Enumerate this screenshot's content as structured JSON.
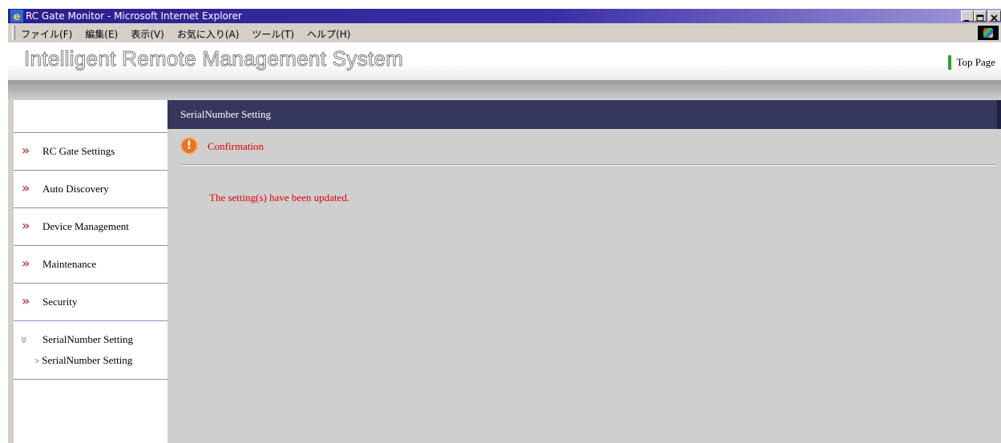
{
  "window": {
    "title": "RC Gate Monitor - Microsoft Internet Explorer",
    "buttons": {
      "minimize": "_",
      "maximize": "□",
      "close": "×"
    }
  },
  "menu": {
    "items": [
      "ファイル(F)",
      "編集(E)",
      "表示(V)",
      "お気に入り(A)",
      "ツール(T)",
      "ヘルプ(H)"
    ]
  },
  "banner": {
    "title": "Intelligent Remote Management System",
    "top_page": "Top Page",
    "accent_color": "#2ea02e"
  },
  "sidebar": {
    "items": [
      {
        "label": "RC Gate Settings",
        "icon": "double-chevron-right-icon"
      },
      {
        "label": "Auto Discovery",
        "icon": "double-chevron-right-icon"
      },
      {
        "label": "Device Management",
        "icon": "double-chevron-right-icon"
      },
      {
        "label": "Maintenance",
        "icon": "double-chevron-right-icon"
      },
      {
        "label": "Security",
        "icon": "double-chevron-right-icon"
      }
    ],
    "expanded": {
      "label": "SerialNumber Setting",
      "icon": "double-chevron-down-icon",
      "sub_items": [
        "SerialNumber Setting"
      ]
    }
  },
  "main": {
    "header": "SerialNumber Setting",
    "confirmation_label": "Confirmation",
    "message": "The setting(s) have been updated.",
    "alert_color": "#e00000",
    "header_color": "#35375f"
  }
}
